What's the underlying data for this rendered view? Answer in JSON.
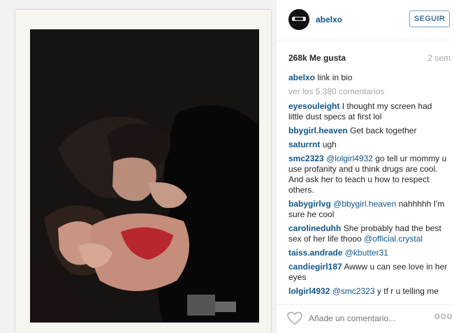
{
  "post": {
    "username": "abelxo",
    "follow_label": "SEGUIR",
    "likes": "268k Me gusta",
    "time": "2 sem",
    "caption_user": "abelxo",
    "caption_text": "link in bio",
    "view_all": "ver los 5,380 comentarios"
  },
  "comments": [
    {
      "user": "eyesouleight",
      "segments": [
        {
          "t": "I thought my screen had little dust specs at first lol"
        }
      ]
    },
    {
      "user": "bbygirl.heaven",
      "segments": [
        {
          "t": "Get back together"
        }
      ]
    },
    {
      "user": "saturrnt",
      "segments": [
        {
          "t": "ugh"
        }
      ]
    },
    {
      "user": "smc2323",
      "segments": [
        {
          "t": "@lolgirl4932",
          "m": true
        },
        {
          "t": " go tell ur mommy u use profanity and u think drugs are cool. And ask her to teach u how to respect others."
        }
      ]
    },
    {
      "user": "babygirlvg",
      "segments": [
        {
          "t": "@bbygirl.heaven",
          "m": true
        },
        {
          "t": " nahhhhh I'm sure he cool"
        }
      ]
    },
    {
      "user": "carolineduhh",
      "segments": [
        {
          "t": "She probably had the best sex of her life thooo "
        },
        {
          "t": "@official.crystal",
          "m": true
        }
      ]
    },
    {
      "user": "taiss.andrade",
      "segments": [
        {
          "t": "@kbutter31",
          "m": true
        }
      ]
    },
    {
      "user": "candiegirl187",
      "segments": [
        {
          "t": "Awww u can see love in her eyes"
        }
      ]
    },
    {
      "user": "lolgirl4932",
      "segments": [
        {
          "t": "@smc2323",
          "m": true
        },
        {
          "t": " y tf r u telling me"
        }
      ]
    }
  ],
  "footer": {
    "placeholder": "Añade un comentario...",
    "more": "ooo"
  },
  "colors": {
    "link": "#125688",
    "muted": "#a5a7aa",
    "follow": "#3f729b"
  }
}
